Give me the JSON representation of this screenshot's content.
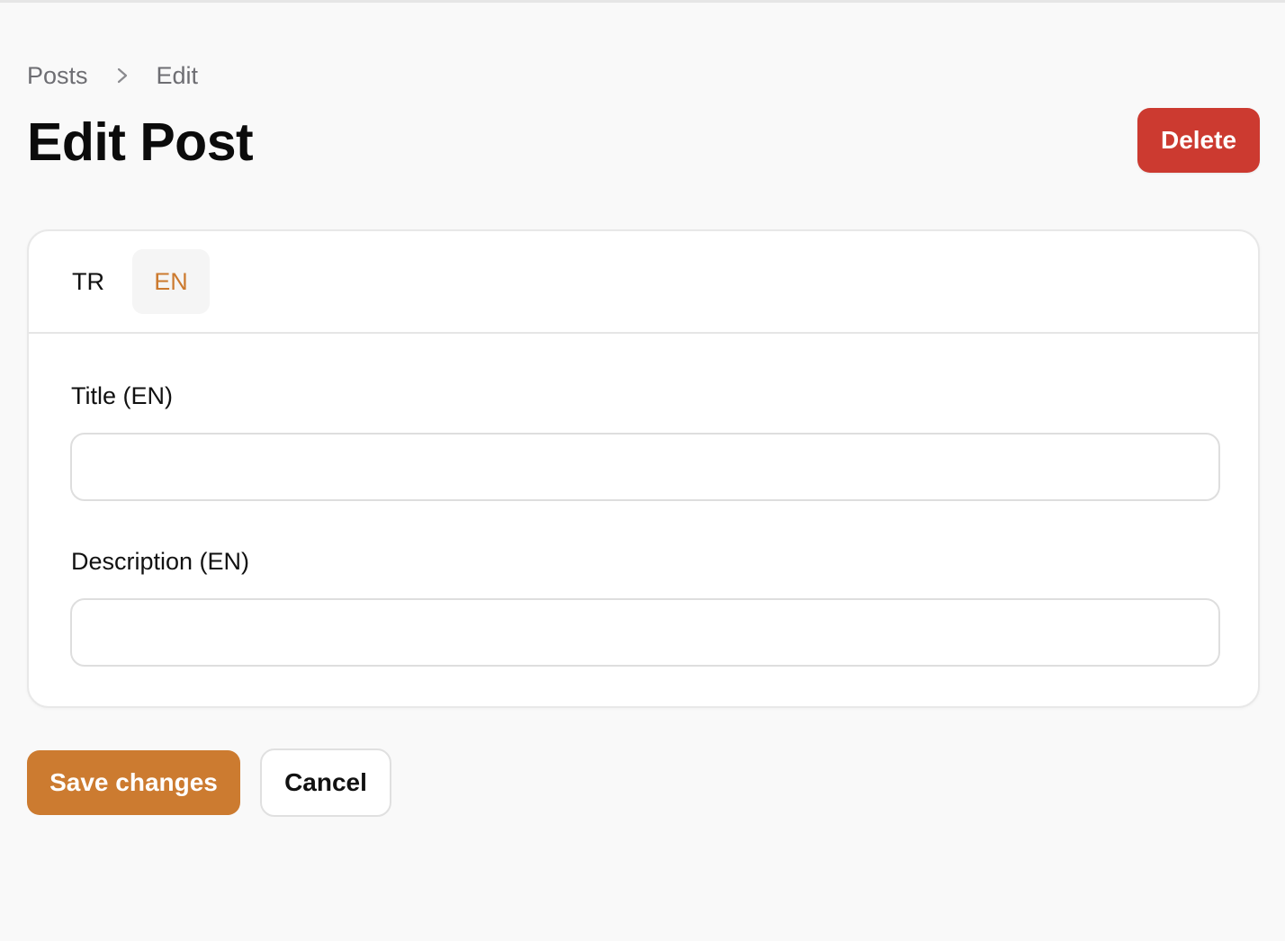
{
  "breadcrumb": {
    "items": [
      "Posts",
      "Edit"
    ],
    "separator_icon": "chevron-right-icon"
  },
  "header": {
    "title": "Edit Post",
    "delete_label": "Delete"
  },
  "tabs": [
    {
      "label": "TR",
      "active": false
    },
    {
      "label": "EN",
      "active": true
    }
  ],
  "form": {
    "title_label": "Title (EN)",
    "title_value": "",
    "description_label": "Description (EN)",
    "description_value": ""
  },
  "actions": {
    "save_label": "Save changes",
    "cancel_label": "Cancel"
  },
  "colors": {
    "accent": "#cc7b30",
    "danger": "#cc3a30",
    "background": "#f9f9f9"
  }
}
